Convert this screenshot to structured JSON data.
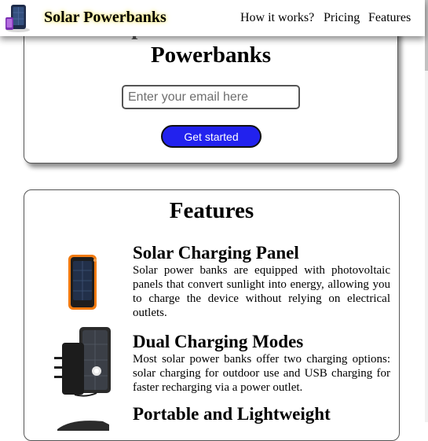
{
  "header": {
    "brand": "Solar Powerbanks",
    "nav": [
      "How it works?",
      "Pricing",
      "Features"
    ]
  },
  "hero": {
    "title_line1": "Super Powerful Solar",
    "title_line2": "Powerbanks",
    "email_placeholder": "Enter your email here",
    "cta_label": "Get started"
  },
  "features": {
    "heading": "Features",
    "items": [
      {
        "title": "Solar Charging Panel",
        "description": "Solar power banks are equipped with photovoltaic panels that convert sunlight into energy, allowing you to charge the device without relying on electrical outlets."
      },
      {
        "title": "Dual Charging Modes",
        "description": "Most solar power banks offer two charging options: solar charging for outdoor use and USB charging for faster recharging via a power outlet."
      },
      {
        "title": "Portable and Lightweight",
        "description": ""
      }
    ]
  },
  "colors": {
    "cta_background": "#2222ee",
    "brand_glow": "#f2e46a"
  },
  "icons": {
    "logo": "solar-powerbank-logo-icon",
    "feature_images": [
      "solar-panel-powerbank-image",
      "dual-charging-powerbank-image",
      "portable-powerbank-image"
    ]
  }
}
